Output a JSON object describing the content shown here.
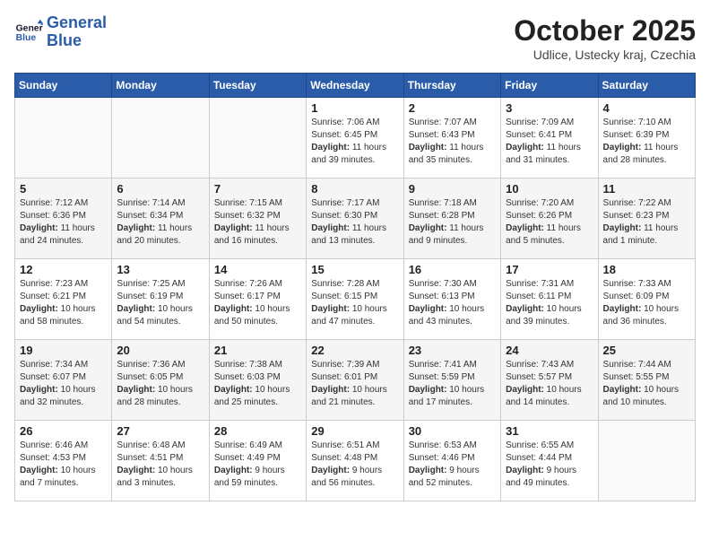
{
  "header": {
    "logo_line1": "General",
    "logo_line2": "Blue",
    "title": "October 2025",
    "subtitle": "Udlice, Ustecky kraj, Czechia"
  },
  "weekdays": [
    "Sunday",
    "Monday",
    "Tuesday",
    "Wednesday",
    "Thursday",
    "Friday",
    "Saturday"
  ],
  "weeks": [
    [
      {
        "day": "",
        "content": ""
      },
      {
        "day": "",
        "content": ""
      },
      {
        "day": "",
        "content": ""
      },
      {
        "day": "1",
        "content": "Sunrise: 7:06 AM\nSunset: 6:45 PM\nDaylight: 11 hours\nand 39 minutes."
      },
      {
        "day": "2",
        "content": "Sunrise: 7:07 AM\nSunset: 6:43 PM\nDaylight: 11 hours\nand 35 minutes."
      },
      {
        "day": "3",
        "content": "Sunrise: 7:09 AM\nSunset: 6:41 PM\nDaylight: 11 hours\nand 31 minutes."
      },
      {
        "day": "4",
        "content": "Sunrise: 7:10 AM\nSunset: 6:39 PM\nDaylight: 11 hours\nand 28 minutes."
      }
    ],
    [
      {
        "day": "5",
        "content": "Sunrise: 7:12 AM\nSunset: 6:36 PM\nDaylight: 11 hours\nand 24 minutes."
      },
      {
        "day": "6",
        "content": "Sunrise: 7:14 AM\nSunset: 6:34 PM\nDaylight: 11 hours\nand 20 minutes."
      },
      {
        "day": "7",
        "content": "Sunrise: 7:15 AM\nSunset: 6:32 PM\nDaylight: 11 hours\nand 16 minutes."
      },
      {
        "day": "8",
        "content": "Sunrise: 7:17 AM\nSunset: 6:30 PM\nDaylight: 11 hours\nand 13 minutes."
      },
      {
        "day": "9",
        "content": "Sunrise: 7:18 AM\nSunset: 6:28 PM\nDaylight: 11 hours\nand 9 minutes."
      },
      {
        "day": "10",
        "content": "Sunrise: 7:20 AM\nSunset: 6:26 PM\nDaylight: 11 hours\nand 5 minutes."
      },
      {
        "day": "11",
        "content": "Sunrise: 7:22 AM\nSunset: 6:23 PM\nDaylight: 11 hours\nand 1 minute."
      }
    ],
    [
      {
        "day": "12",
        "content": "Sunrise: 7:23 AM\nSunset: 6:21 PM\nDaylight: 10 hours\nand 58 minutes."
      },
      {
        "day": "13",
        "content": "Sunrise: 7:25 AM\nSunset: 6:19 PM\nDaylight: 10 hours\nand 54 minutes."
      },
      {
        "day": "14",
        "content": "Sunrise: 7:26 AM\nSunset: 6:17 PM\nDaylight: 10 hours\nand 50 minutes."
      },
      {
        "day": "15",
        "content": "Sunrise: 7:28 AM\nSunset: 6:15 PM\nDaylight: 10 hours\nand 47 minutes."
      },
      {
        "day": "16",
        "content": "Sunrise: 7:30 AM\nSunset: 6:13 PM\nDaylight: 10 hours\nand 43 minutes."
      },
      {
        "day": "17",
        "content": "Sunrise: 7:31 AM\nSunset: 6:11 PM\nDaylight: 10 hours\nand 39 minutes."
      },
      {
        "day": "18",
        "content": "Sunrise: 7:33 AM\nSunset: 6:09 PM\nDaylight: 10 hours\nand 36 minutes."
      }
    ],
    [
      {
        "day": "19",
        "content": "Sunrise: 7:34 AM\nSunset: 6:07 PM\nDaylight: 10 hours\nand 32 minutes."
      },
      {
        "day": "20",
        "content": "Sunrise: 7:36 AM\nSunset: 6:05 PM\nDaylight: 10 hours\nand 28 minutes."
      },
      {
        "day": "21",
        "content": "Sunrise: 7:38 AM\nSunset: 6:03 PM\nDaylight: 10 hours\nand 25 minutes."
      },
      {
        "day": "22",
        "content": "Sunrise: 7:39 AM\nSunset: 6:01 PM\nDaylight: 10 hours\nand 21 minutes."
      },
      {
        "day": "23",
        "content": "Sunrise: 7:41 AM\nSunset: 5:59 PM\nDaylight: 10 hours\nand 17 minutes."
      },
      {
        "day": "24",
        "content": "Sunrise: 7:43 AM\nSunset: 5:57 PM\nDaylight: 10 hours\nand 14 minutes."
      },
      {
        "day": "25",
        "content": "Sunrise: 7:44 AM\nSunset: 5:55 PM\nDaylight: 10 hours\nand 10 minutes."
      }
    ],
    [
      {
        "day": "26",
        "content": "Sunrise: 6:46 AM\nSunset: 4:53 PM\nDaylight: 10 hours\nand 7 minutes."
      },
      {
        "day": "27",
        "content": "Sunrise: 6:48 AM\nSunset: 4:51 PM\nDaylight: 10 hours\nand 3 minutes."
      },
      {
        "day": "28",
        "content": "Sunrise: 6:49 AM\nSunset: 4:49 PM\nDaylight: 9 hours\nand 59 minutes."
      },
      {
        "day": "29",
        "content": "Sunrise: 6:51 AM\nSunset: 4:48 PM\nDaylight: 9 hours\nand 56 minutes."
      },
      {
        "day": "30",
        "content": "Sunrise: 6:53 AM\nSunset: 4:46 PM\nDaylight: 9 hours\nand 52 minutes."
      },
      {
        "day": "31",
        "content": "Sunrise: 6:55 AM\nSunset: 4:44 PM\nDaylight: 9 hours\nand 49 minutes."
      },
      {
        "day": "",
        "content": ""
      }
    ]
  ]
}
